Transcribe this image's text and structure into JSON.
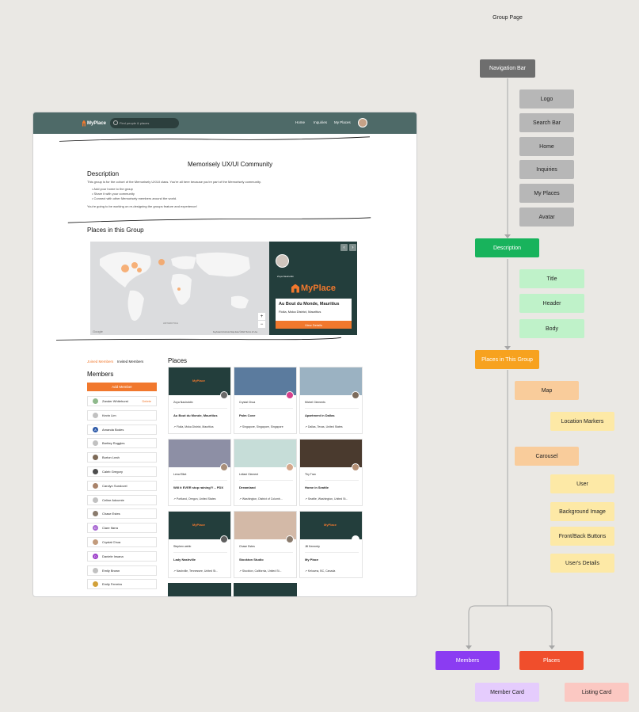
{
  "flow": {
    "root": "Group Page",
    "navigation": {
      "label": "Navigation Bar",
      "children": [
        "Logo",
        "Search Bar",
        "Home",
        "Inquiries",
        "My Places",
        "Avatar"
      ]
    },
    "description": {
      "label": "Description",
      "children": [
        "Title",
        "Header",
        "Body"
      ]
    },
    "places_group": {
      "label": "Places in This Group",
      "map": "Map",
      "map_children": [
        "Location Markers"
      ],
      "carousel": "Carousel",
      "carousel_children": [
        "User",
        "Background Image",
        "Front/Back Buttons",
        "User's Details"
      ]
    },
    "members": "Members",
    "places": "Places",
    "member_card": "Member Card",
    "listing_card": "Listing Card"
  },
  "mockup": {
    "logo": {
      "main": "MyPlace",
      "sub": "Memorisely"
    },
    "search_placeholder": "Find people & places",
    "nav_links": [
      "Home",
      "Inquiries",
      "My Places"
    ],
    "community_title": "Memorisely UX/UI Community",
    "description_header": "Description",
    "description_intro": "This group is for the cohort of the Memorisely UX/UI class. You're all here because you're part of the Memorisely community.",
    "bullets": [
      "Add your home to the group",
      "Share it with your community",
      "Connect with other Memorisely members around the world."
    ],
    "description_outro": "You're going to be working on re-designing the groups feature and experience!",
    "places_header": "Places in this Group",
    "map_google": "Google",
    "map_footer": "Keyboard shortcuts   Map data ©2022   Terms of Use",
    "map_zoom_plus": "+",
    "map_zoom_minus": "−",
    "carousel": {
      "user": "Zoya Nasirutdin",
      "brand": "MyPlace",
      "brand_sub": "Memorisely",
      "place_title": "Au Bout du Monde, Mauritius",
      "place_location": "Flolia, Moka District, Mauritius",
      "button": "View Details",
      "prev": "‹",
      "next": "›"
    },
    "tabs": [
      "Joined Members",
      "Invited Members"
    ],
    "members_header": "Members",
    "add_member": "Add Member",
    "members": [
      {
        "name": "Zander Whitehurst",
        "action": "Delete",
        "color": "#8fb98c",
        "initial": ""
      },
      {
        "name": "Kevin Lim",
        "action": "",
        "color": "#c1c1c1",
        "initial": ""
      },
      {
        "name": "Amanda Bodes",
        "action": "",
        "color": "#2e5aa8",
        "initial": "A"
      },
      {
        "name": "Brettey Ruggles",
        "action": "",
        "color": "#c1c1c1",
        "initial": ""
      },
      {
        "name": "Burton Leah",
        "action": "",
        "color": "#7d6a57",
        "initial": ""
      },
      {
        "name": "Caleb Gregory",
        "action": "",
        "color": "#4d4d4d",
        "initial": ""
      },
      {
        "name": "Carolyn Sundovel",
        "action": "",
        "color": "#a9836a",
        "initial": ""
      },
      {
        "name": "Celine Adcumie",
        "action": "",
        "color": "#c1c1c1",
        "initial": ""
      },
      {
        "name": "Chase Estes",
        "action": "",
        "color": "#8a7b6d",
        "initial": ""
      },
      {
        "name": "Clare Ifarra",
        "action": "",
        "color": "#a96ad2",
        "initial": "C"
      },
      {
        "name": "Crystal Chua",
        "action": "",
        "color": "#c29b7c",
        "initial": ""
      },
      {
        "name": "Daniele Insana",
        "action": "",
        "color": "#9c3fc9",
        "initial": "D"
      },
      {
        "name": "Emily Brown",
        "action": "",
        "color": "#c1c1c1",
        "initial": ""
      },
      {
        "name": "Emily Ferreira",
        "action": "",
        "color": "#d2a13a",
        "initial": ""
      }
    ],
    "places_list_header": "Places",
    "listings": [
      {
        "user": "Zoya Nasirutdin",
        "title": "Au Bout du Monde, Mauritius",
        "loc": "Flolia, Moka District, Mauritius",
        "img": "#233e3c",
        "brand": "MyPlace",
        "avatar": "#6a6a6a"
      },
      {
        "user": "Crystal Chua",
        "title": "Palm Cove",
        "loc": "Singapore, Singapore, Singapore",
        "img": "#5b7b9e",
        "brand": "",
        "avatar": "#d6408c"
      },
      {
        "user": "Michel Clements",
        "title": "Apartment in Dallas",
        "loc": "Dallas, Texas, United States",
        "img": "#9bb2c2",
        "brand": "",
        "avatar": "#7c6b5c"
      },
      {
        "user": "Lena Elliot",
        "title": "Will it EVER stop raining?! – PDX",
        "loc": "Portland, Oregon, United States",
        "img": "#8d8fa5",
        "brand": "",
        "avatar": "#a88e79"
      },
      {
        "user": "Leilani Clement",
        "title": "Dreamland",
        "loc": "Washington, District of Columb...",
        "img": "#c6ddd8",
        "brand": "",
        "avatar": "#d4a78b"
      },
      {
        "user": "Thy Tran",
        "title": "Home in Seattle",
        "loc": "Seattle, Washington, United St...",
        "img": "#4a3a2e",
        "brand": "",
        "avatar": "#b48f74"
      },
      {
        "user": "Stephen webb",
        "title": "Lady Nashville",
        "loc": "Nashville, Tennessee, United St...",
        "img": "#233e3c",
        "brand": "MyPlace",
        "avatar": "#5e5e5e"
      },
      {
        "user": "Chase Estes",
        "title": "Stockton Studio",
        "loc": "Stockton, California, United St...",
        "img": "#d3b9a7",
        "brand": "",
        "avatar": "#8a7b6d"
      },
      {
        "user": "Jill Kennedy",
        "title": "My Place",
        "loc": "Kelowna, BC, Canada",
        "img": "#233e3c",
        "brand": "MyPlace",
        "avatar": "#ffffff"
      }
    ]
  }
}
